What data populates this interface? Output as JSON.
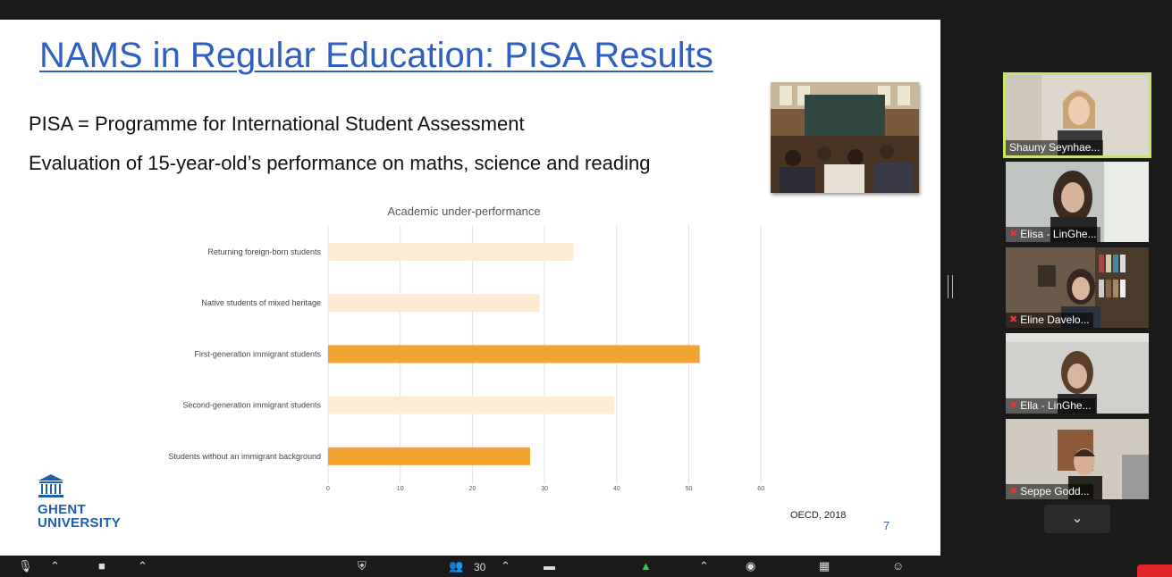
{
  "slide": {
    "title": "NAMS in Regular Education: PISA Results",
    "line1": "PISA = Programme for International Student Assessment",
    "line2": "Evaluation of 15-year-old’s performance on maths, science and reading",
    "logo_line1": "GHENT",
    "logo_line2": "UNIVERSITY",
    "source": "OECD, 2018",
    "page_number": "7"
  },
  "chart_data": {
    "type": "bar",
    "orientation": "horizontal",
    "title": "Academic under-performance",
    "categories": [
      "Returning foreign-born students",
      "Native students of mixed heritage",
      "First-generation immigrant students",
      "Second-generation immigrant students",
      "Students without an immigrant background"
    ],
    "values": [
      34,
      29.3,
      51.5,
      39.7,
      28
    ],
    "highlighted": [
      false,
      false,
      true,
      false,
      true
    ],
    "xlim": [
      0,
      60
    ],
    "xticks": [
      0,
      10,
      20,
      30,
      40,
      50,
      60
    ],
    "colors": {
      "light": "#fdebd3",
      "highlight": "#f2a431"
    },
    "grid": true
  },
  "participants": [
    {
      "name": "Shauny Seynhae...",
      "muted": false,
      "active": true
    },
    {
      "name": "Elisa - LinGhe...",
      "muted": true,
      "active": false
    },
    {
      "name": "Eline Davelo...",
      "muted": true,
      "active": false
    },
    {
      "name": "Ella - LinGhe...",
      "muted": true,
      "active": false
    },
    {
      "name": "Seppe Godd...",
      "muted": true,
      "active": false
    }
  ],
  "toolbar": {
    "participant_count": "30"
  }
}
